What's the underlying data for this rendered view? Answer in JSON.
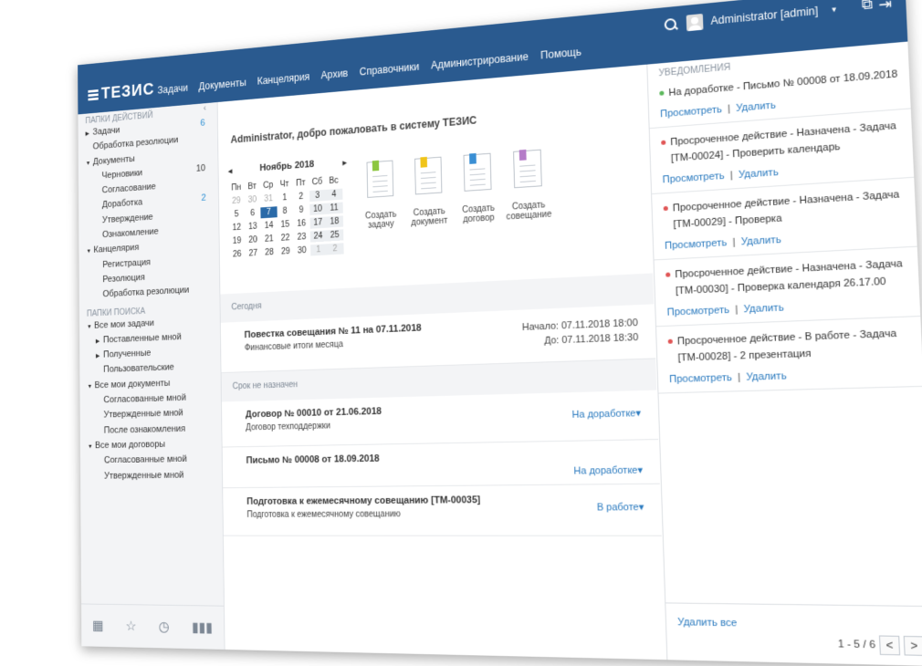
{
  "header": {
    "logo": "ТЕЗИС",
    "menu": [
      "Задачи",
      "Документы",
      "Канцелярия",
      "Архив",
      "Справочники",
      "Администрирование",
      "Помощь"
    ],
    "user": "Administrator [admin]"
  },
  "sidebar": {
    "actions_title": "ПАПКИ ДЕЙСТВИЙ",
    "collapse_icon": "chevron-left-icon",
    "items": [
      {
        "label": "Задачи",
        "level": 0,
        "tri": "right",
        "count": "6",
        "count_color": "#2a8fd4"
      },
      {
        "label": "Обработка резолюции",
        "level": 0,
        "tri": "",
        "count": ""
      },
      {
        "label": "Документы",
        "level": 0,
        "tri": "down",
        "count": ""
      },
      {
        "label": "Черновики",
        "level": 1,
        "tri": "",
        "count": "10"
      },
      {
        "label": "Согласование",
        "level": 1,
        "tri": "",
        "count": ""
      },
      {
        "label": "Доработка",
        "level": 1,
        "tri": "",
        "count": "2",
        "count_color": "#2a8fd4"
      },
      {
        "label": "Утверждение",
        "level": 1,
        "tri": "",
        "count": ""
      },
      {
        "label": "Ознакомление",
        "level": 1,
        "tri": "",
        "count": ""
      },
      {
        "label": "Канцелярия",
        "level": 0,
        "tri": "down",
        "count": ""
      },
      {
        "label": "Регистрация",
        "level": 1,
        "tri": "",
        "count": ""
      },
      {
        "label": "Резолюция",
        "level": 1,
        "tri": "",
        "count": ""
      },
      {
        "label": "Обработка резолюции",
        "level": 1,
        "tri": "",
        "count": ""
      }
    ],
    "search_title": "ПАПКИ ПОИСКА",
    "search_items": [
      {
        "label": "Все мои задачи",
        "level": 0,
        "tri": "down"
      },
      {
        "label": "Поставленные мной",
        "level": 1,
        "tri": "right"
      },
      {
        "label": "Полученные",
        "level": 1,
        "tri": "right"
      },
      {
        "label": "Пользовательские",
        "level": 1,
        "tri": ""
      },
      {
        "label": "Все мои документы",
        "level": 0,
        "tri": "down"
      },
      {
        "label": "Согласованные мной",
        "level": 1,
        "tri": ""
      },
      {
        "label": "Утвержденные мной",
        "level": 1,
        "tri": ""
      },
      {
        "label": "После ознакомления",
        "level": 1,
        "tri": ""
      },
      {
        "label": "Все мои договоры",
        "level": 0,
        "tri": "down"
      },
      {
        "label": "Согласованные мной",
        "level": 1,
        "tri": ""
      },
      {
        "label": "Утвержденные мной",
        "level": 1,
        "tri": ""
      }
    ],
    "footer_icons": [
      "calendar-icon",
      "star-icon",
      "clock-icon",
      "chart-icon"
    ]
  },
  "main": {
    "welcome": "Administrator, добро пожаловать в систему ТЕЗИС",
    "calendar": {
      "prev": "◂",
      "next": "▸",
      "month": "Ноябрь 2018",
      "weekdays": [
        "Пн",
        "Вт",
        "Ср",
        "Чт",
        "Пт",
        "Сб",
        "Вс"
      ],
      "weeks": [
        [
          "29",
          "30",
          "31",
          "1",
          "2",
          "3",
          "4"
        ],
        [
          "5",
          "6",
          "7",
          "8",
          "9",
          "10",
          "11"
        ],
        [
          "12",
          "13",
          "14",
          "15",
          "16",
          "17",
          "18"
        ],
        [
          "19",
          "20",
          "21",
          "22",
          "23",
          "24",
          "25"
        ],
        [
          "26",
          "27",
          "28",
          "29",
          "30",
          "1",
          "2"
        ]
      ],
      "selected": "7"
    },
    "quick_actions": [
      {
        "label1": "Создать",
        "label2": "задачу",
        "color": "#8cc63f",
        "icon": "task-icon"
      },
      {
        "label1": "Создать",
        "label2": "документ",
        "color": "#f0c419",
        "icon": "document-icon"
      },
      {
        "label1": "Создать",
        "label2": "договор",
        "color": "#3a8fd4",
        "icon": "contract-icon"
      },
      {
        "label1": "Создать",
        "label2": "совещание",
        "color": "#b57cc8",
        "icon": "meeting-icon"
      }
    ],
    "sections": [
      {
        "title": "Сегодня"
      },
      {
        "title": "Срок не назначен"
      }
    ],
    "today_rows": [
      {
        "title": "Повестка совещания № 11 на 07.11.2018",
        "sub": "Финансовые итоги месяца",
        "start": "Начало: 07.11.2018 18:00",
        "end": "До: 07.11.2018 18:30"
      }
    ],
    "nodate_rows": [
      {
        "title": "Договор № 00010 от 21.06.2018",
        "sub": "Договор техподдержки",
        "status": "На доработке"
      },
      {
        "title": "Письмо № 00008 от 18.09.2018",
        "sub": "",
        "status": "На доработке"
      },
      {
        "title": "Подготовка к ежемесячному совещанию [ТМ-00035]",
        "sub": "Подготовка к ежемесячному совещанию",
        "status": "В работе"
      }
    ],
    "status_caret": "▾"
  },
  "notifications": {
    "title": "УВЕДОМЛЕНИЯ",
    "items": [
      {
        "text": "На доработке - Письмо № 00008 от 18.09.2018",
        "dot": "#5cb85c"
      },
      {
        "text": "Просроченное действие - Назначена - Задача [ТМ-00024] - Проверить календарь",
        "dot": "#e05555"
      },
      {
        "text": "Просроченное действие - Назначена - Задача [ТМ-00029] - Проверка",
        "dot": "#e05555"
      },
      {
        "text": "Просроченное действие - Назначена - Задача [ТМ-00030] - Проверка календаря 26.17.00",
        "dot": "#e05555"
      },
      {
        "text": "Просроченное действие - В работе - Задача [ТМ-00028] - 2 презентация",
        "dot": "#e05555"
      }
    ],
    "view": "Просмотреть",
    "sep": "|",
    "delete": "Удалить",
    "delete_all": "Удалить все",
    "pager": "1 - 5 / 6",
    "prev": "<",
    "next": ">"
  }
}
